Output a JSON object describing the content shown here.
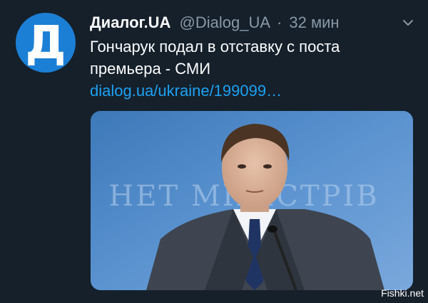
{
  "tweet": {
    "avatar_letter": "Д",
    "author_name": "Диалог.UA",
    "handle": "@Dialog_UA",
    "separator": "·",
    "time": "32 мин",
    "text_line": "Гончарук подал в отставку с поста премьера - СМИ",
    "link_text": "dialog.ua/ukraine/199099…",
    "media_icon": "photo",
    "media_background_text": "НЕТ МІНІСТРІВ"
  },
  "watermark": "Fishki.net",
  "colors": {
    "background": "#15202b",
    "avatar": "#1c7fd6",
    "link": "#1da1f2",
    "muted": "#8899a6"
  }
}
